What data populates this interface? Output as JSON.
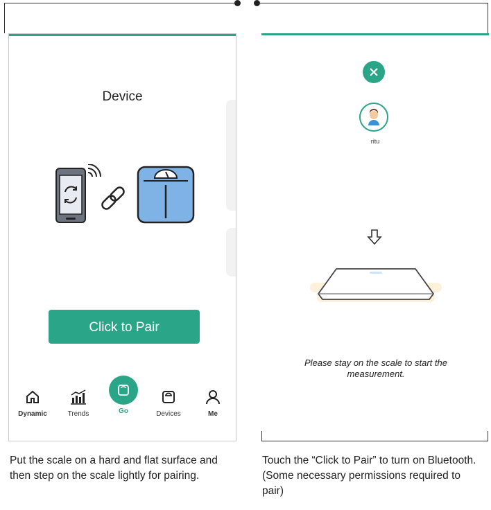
{
  "left_screen": {
    "title": "Device",
    "pair_button_label": "Click to Pair",
    "nav": [
      {
        "label": "Dynamic",
        "icon": "home-icon"
      },
      {
        "label": "Trends",
        "icon": "trends-icon"
      },
      {
        "label": "Go",
        "icon": "scale-icon",
        "active": true
      },
      {
        "label": "Devices",
        "icon": "device-icon"
      },
      {
        "label": "Me",
        "icon": "person-icon"
      }
    ]
  },
  "right_screen": {
    "user_name": "ritu",
    "instruction": "Please stay on the scale to start the measurement."
  },
  "captions": {
    "left": "Put the scale on a hard and flat surface and then step on the scale lightly for pairing.",
    "right": "Touch the “Click to Pair” to turn on Bluetooth. (Some necessary permissions required to pair)"
  },
  "colors": {
    "accent": "#2aa587",
    "scale_blue": "#7fb2e5"
  }
}
